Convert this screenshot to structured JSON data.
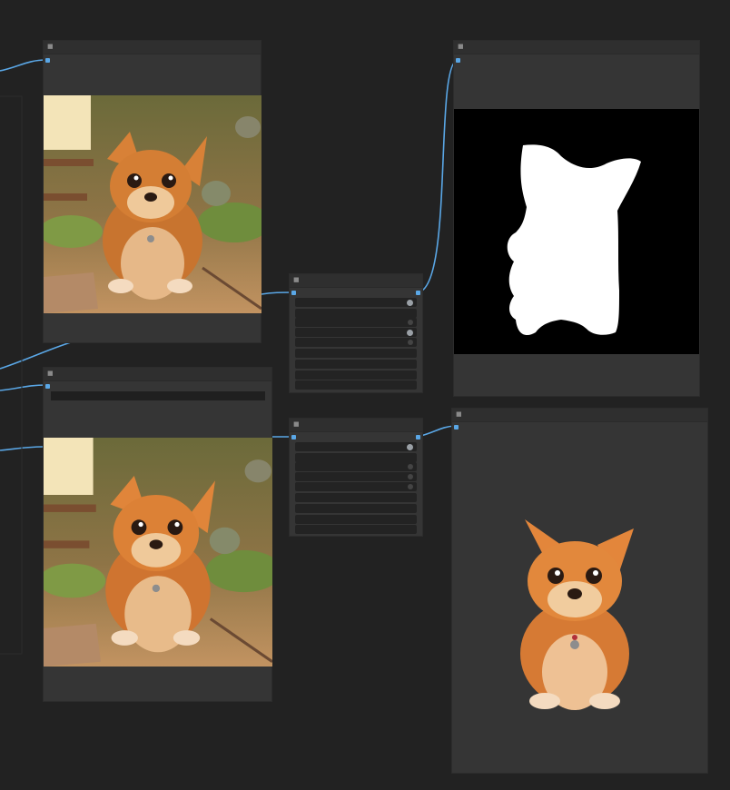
{
  "canvas": {
    "background": "#222222",
    "wire_color": "#5aa7e6"
  },
  "nodes": {
    "load_image_top": {
      "kind": "image-preview"
    },
    "load_image_bottom": {
      "kind": "image-preview"
    },
    "remove_bg_settings_top": {
      "kind": "settings",
      "rows": 7
    },
    "remove_bg_settings_bottom": {
      "kind": "settings",
      "rows": 7
    },
    "mask_preview": {
      "kind": "mask-preview",
      "mask_color": "#ffffff",
      "bg_color": "#000000"
    },
    "cutout_preview": {
      "kind": "image-preview"
    }
  },
  "icons": {
    "collapse": "collapse-dot-icon",
    "port": "connection-port-icon"
  }
}
